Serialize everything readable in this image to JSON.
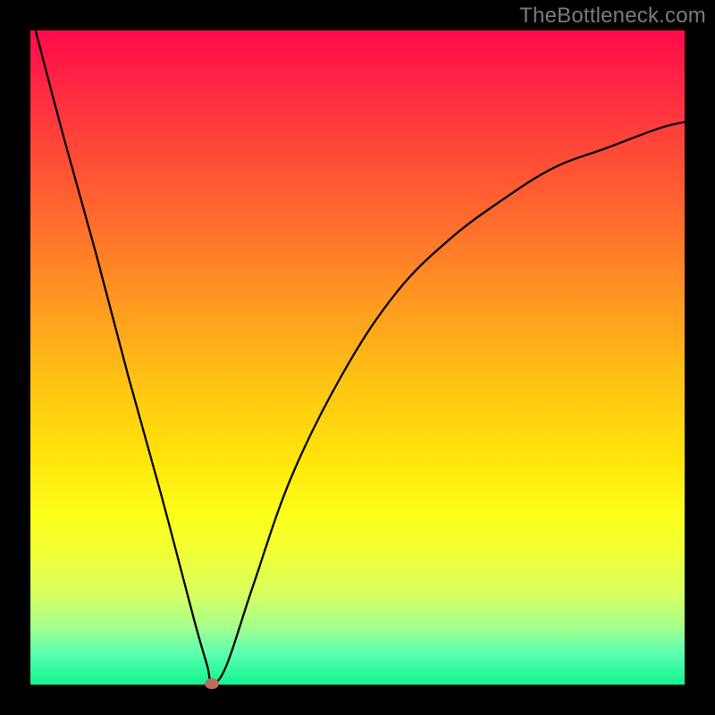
{
  "watermark": "TheBottleneck.com",
  "chart_data": {
    "type": "line",
    "title": "",
    "xlabel": "",
    "ylabel": "",
    "xlim": [
      0,
      1
    ],
    "ylim": [
      0,
      1
    ],
    "series": [
      {
        "name": "bottleneck-curve",
        "x": [
          0.0,
          0.05,
          0.1,
          0.15,
          0.2,
          0.25,
          0.27,
          0.278,
          0.3,
          0.34,
          0.4,
          0.48,
          0.56,
          0.64,
          0.72,
          0.8,
          0.88,
          0.96,
          1.0
        ],
        "values": [
          1.03,
          0.84,
          0.66,
          0.47,
          0.29,
          0.1,
          0.03,
          0.002,
          0.03,
          0.15,
          0.32,
          0.48,
          0.6,
          0.68,
          0.74,
          0.79,
          0.82,
          0.85,
          0.86
        ]
      }
    ],
    "marker": {
      "x": 0.278,
      "y": 0.002,
      "name": "optimum-point"
    },
    "colors": {
      "curve": "#000000",
      "marker": "#bd6a60",
      "gradient_top": "#ff0a4b",
      "gradient_bottom": "#10f590",
      "frame": "#000000"
    },
    "grid": false,
    "legend": false
  }
}
